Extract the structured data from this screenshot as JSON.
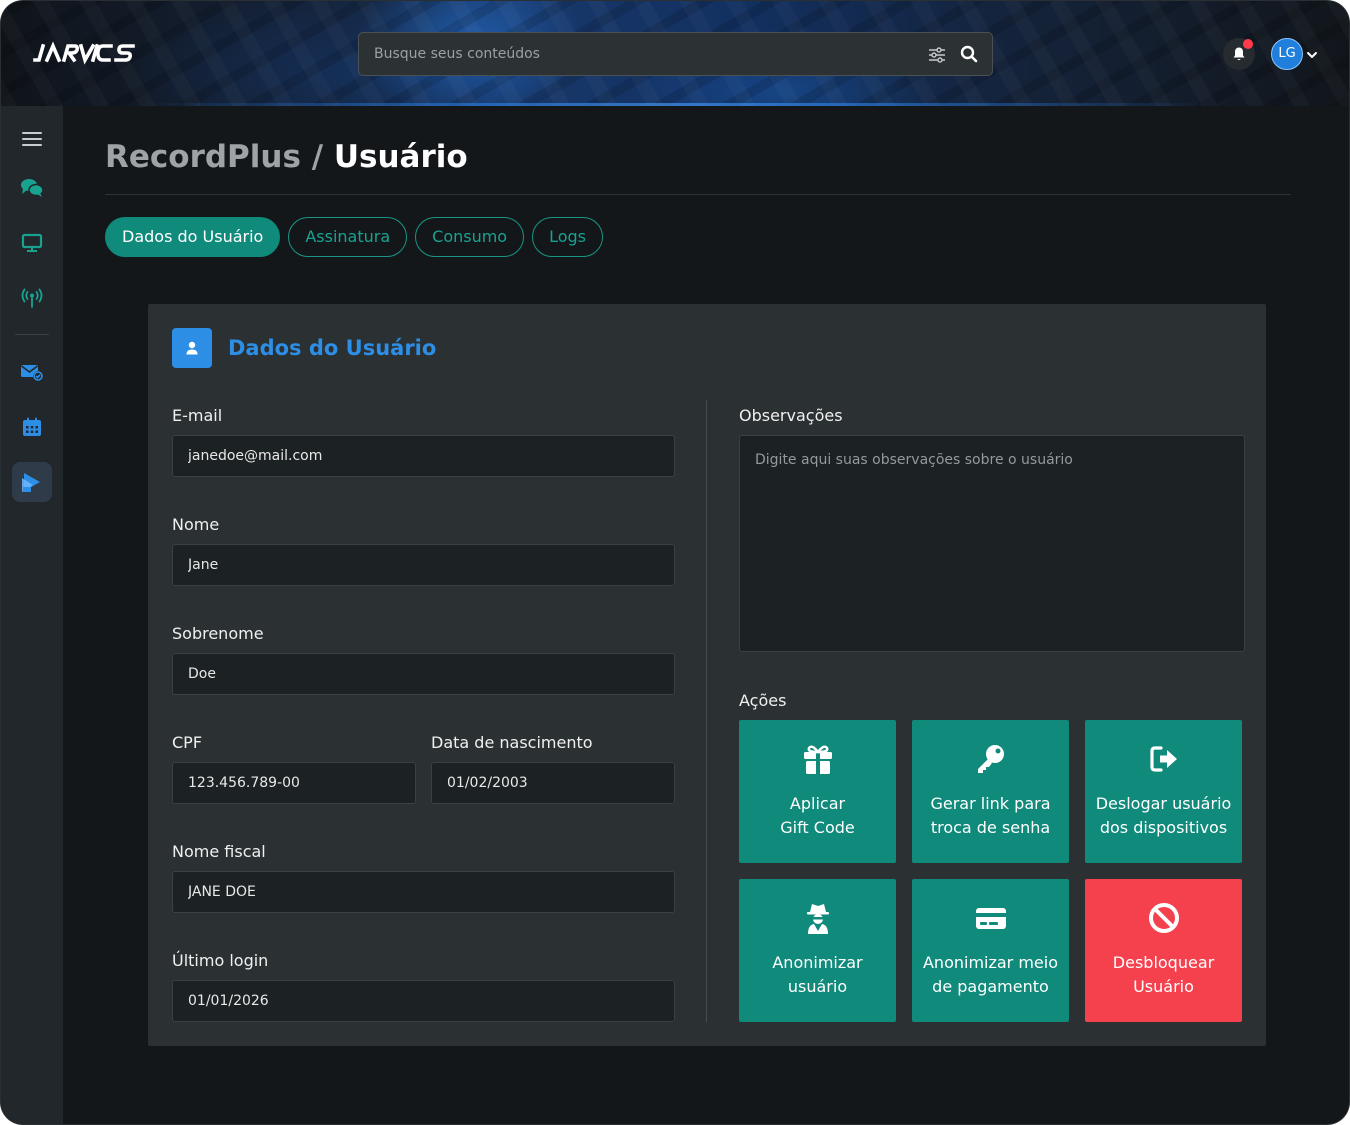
{
  "app": {
    "logo": "JARVICS"
  },
  "header": {
    "search_placeholder": "Busque seus conteúdos",
    "avatar_initials": "LG"
  },
  "page": {
    "breadcrumb_parent": "RecordPlus",
    "separator": "/",
    "current": "Usuário"
  },
  "tabs": [
    {
      "label": "Dados do Usuário",
      "active": true
    },
    {
      "label": "Assinatura",
      "active": false
    },
    {
      "label": "Consumo",
      "active": false
    },
    {
      "label": "Logs",
      "active": false
    }
  ],
  "card": {
    "title": "Dados do Usuário",
    "fields": {
      "email": {
        "label": "E-mail",
        "value": "janedoe@mail.com"
      },
      "nome": {
        "label": "Nome",
        "value": "Jane"
      },
      "sobrenome": {
        "label": "Sobrenome",
        "value": "Doe"
      },
      "cpf": {
        "label": "CPF",
        "value": "123.456.789-00"
      },
      "nascimento": {
        "label": "Data de nascimento",
        "value": "01/02/2003"
      },
      "nome_fiscal": {
        "label": "Nome fiscal",
        "value": "JANE DOE"
      },
      "ultimo_login": {
        "label": "Último login",
        "value": "01/01/2026"
      }
    },
    "observacoes": {
      "label": "Observações",
      "placeholder": "Digite aqui suas observações sobre o usuário"
    },
    "acoes": {
      "label": "Ações",
      "items": [
        {
          "label": "Aplicar\nGift Code",
          "icon": "gift-icon"
        },
        {
          "label": "Gerar link para\ntroca de senha",
          "icon": "key-icon"
        },
        {
          "label": "Deslogar usuário\ndos dispositivos",
          "icon": "logout-icon"
        },
        {
          "label": "Anonimizar\nusuário",
          "icon": "incognito-icon"
        },
        {
          "label": "Anonimizar meio\nde pagamento",
          "icon": "credit-card-icon"
        },
        {
          "label": "Desbloquear\nUsuário",
          "icon": "ban-icon"
        }
      ]
    }
  },
  "colors": {
    "accent_teal": "#0f8a7b",
    "accent_blue": "#2d8ee6",
    "danger": "#f5414e",
    "background": "#13171a",
    "card": "#2b3033"
  }
}
